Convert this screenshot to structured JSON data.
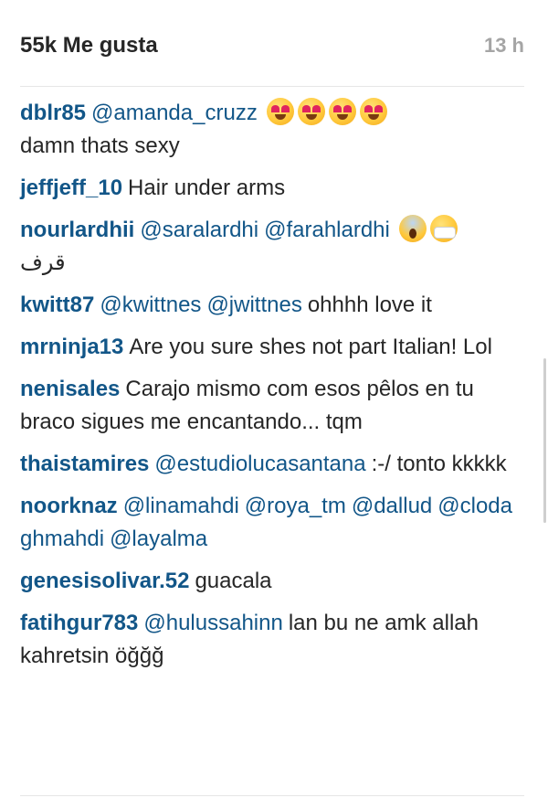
{
  "header": {
    "likes": "55k Me gusta",
    "time": "13 h"
  },
  "comments": [
    {
      "user": "dblr85",
      "mentions": [
        "@amanda_cruzz"
      ],
      "emojis": [
        "heart-eyes",
        "heart-eyes",
        "heart-eyes",
        "heart-eyes"
      ],
      "text": "damn thats sexy"
    },
    {
      "user": "jeffjeff_10",
      "text": "Hair under arms"
    },
    {
      "user": "nourlardhii",
      "mentions": [
        "@saralardhi",
        "@farahlardhi"
      ],
      "emojis": [
        "scream",
        "mask"
      ],
      "arabic": "قرف"
    },
    {
      "user": "kwitt87",
      "mentions": [
        "@kwittnes",
        "@jwittnes"
      ],
      "text": "ohhhh love it"
    },
    {
      "user": "mrninja13",
      "text": "Are you sure shes not part Italian! Lol"
    },
    {
      "user": "nenisales",
      "text": "Carajo mismo com esos pêlos en tu braco sigues me encantando... tqm"
    },
    {
      "user": "thaistamires",
      "mentions": [
        "@estudiolucasantana"
      ],
      "text": ":-/ tonto kkkkk"
    },
    {
      "user": "noorknaz",
      "mentions": [
        "@linamahdi",
        "@roya_tm",
        "@dallud",
        "@clodaghmahdi",
        "@layalma"
      ]
    },
    {
      "user": "genesisolivar.52",
      "text": "guacala"
    },
    {
      "user": "fatihgur783",
      "mentions": [
        "@hulussahinn"
      ],
      "text": "lan bu ne amk allah kahretsin öğğğ"
    }
  ]
}
